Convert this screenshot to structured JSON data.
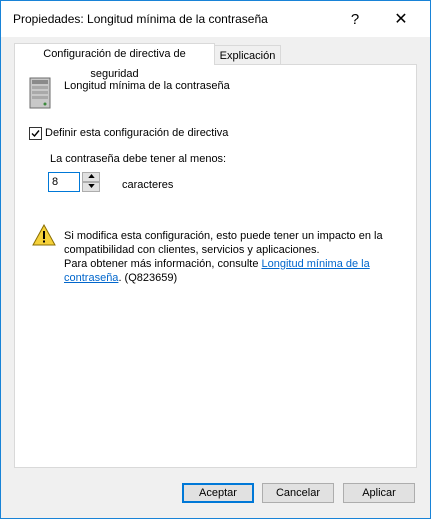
{
  "window": {
    "title": "Propiedades: Longitud mínima de la contraseña",
    "help_glyph": "?",
    "close_glyph": "✕"
  },
  "tabs": [
    {
      "label": "Configuración de directiva de seguridad",
      "active": true
    },
    {
      "label": "Explicación",
      "active": false
    }
  ],
  "policy": {
    "icon": "server-icon",
    "name": "Longitud mínima de la contraseña",
    "define_label": "Definir esta configuración de directiva",
    "define_checked": true,
    "min_label": "La contraseña debe tener al menos:",
    "value": "8",
    "unit": "caracteres"
  },
  "warning": {
    "icon": "warning-icon",
    "line1": "Si modifica esta configuración, esto puede tener un impacto en la compatibilidad con clientes, servicios y aplicaciones.",
    "line2_prefix": "Para obtener más información, consulte ",
    "link": "Longitud mínima de la contraseña",
    "suffix": ". (Q823659)"
  },
  "buttons": {
    "accept": "Aceptar",
    "cancel": "Cancelar",
    "apply": "Aplicar"
  },
  "colors": {
    "accent": "#0078d7",
    "window_border": "#1883d7",
    "link": "#0066cc"
  }
}
